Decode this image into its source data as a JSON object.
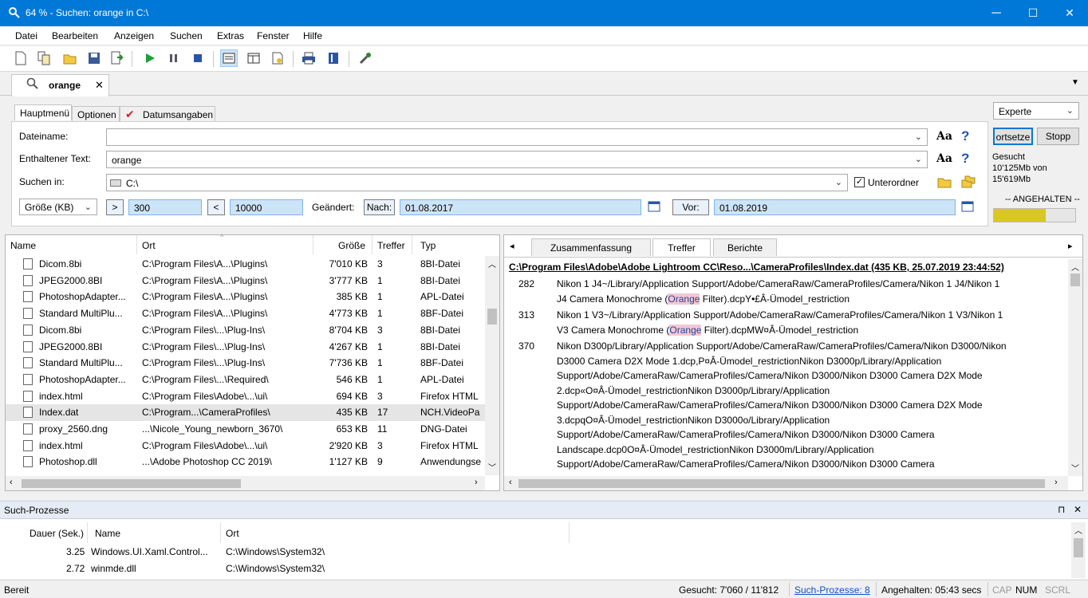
{
  "window": {
    "title": "64 % - Suchen: orange in C:\\",
    "minimize": "─",
    "maximize": "☐",
    "close": "✕",
    "app_icon": "search-flame-icon"
  },
  "menu": [
    "Datei",
    "Bearbeiten",
    "Anzeigen",
    "Suchen",
    "Extras",
    "Fenster",
    "Hilfe"
  ],
  "doc_tab": {
    "label": "orange",
    "close": "✕"
  },
  "search_panel": {
    "subtabs": [
      "Hauptmenü",
      "Optionen",
      "Datumsangaben"
    ],
    "filename_label": "Dateiname:",
    "filename_value": "",
    "contains_label": "Enthaltener Text:",
    "contains_value": "orange",
    "lookin_label": "Suchen in:",
    "lookin_value": "C:\\",
    "subfolders_label": "Unterordner",
    "size_filter": "Größe (KB)",
    "gt": ">",
    "size_min": "300",
    "lt": "<",
    "size_max": "10000",
    "changed_label": "Geändert:",
    "after_label": "Nach:",
    "after_value": "01.08.2017",
    "before_label": "Vor:",
    "before_value": "01.08.2019",
    "aa": "Aa",
    "help": "?"
  },
  "side": {
    "mode": "Experte",
    "continue": "ortsetze",
    "stop": "Stopp",
    "searched_label": "Gesucht",
    "searched_value": "10'125Mb von",
    "searched_total": "15'619Mb",
    "status": "-- ANGEHALTEN --",
    "progress": 0.64
  },
  "results": {
    "headers": [
      "Name",
      "Ort",
      "Größe",
      "Treffer",
      "Typ"
    ],
    "rows": [
      {
        "name": "Dicom.8bi",
        "ort": "C:\\Program Files\\A...\\Plugins\\",
        "size": "7'010 KB",
        "hits": "3",
        "type": "8BI-Datei"
      },
      {
        "name": "JPEG2000.8BI",
        "ort": "C:\\Program Files\\A...\\Plugins\\",
        "size": "3'777 KB",
        "hits": "1",
        "type": "8BI-Datei"
      },
      {
        "name": "PhotoshopAdapter...",
        "ort": "C:\\Program Files\\A...\\Plugins\\",
        "size": "385 KB",
        "hits": "1",
        "type": "APL-Datei"
      },
      {
        "name": "Standard MultiPlu...",
        "ort": "C:\\Program Files\\A...\\Plugins\\",
        "size": "4'773 KB",
        "hits": "1",
        "type": "8BF-Datei"
      },
      {
        "name": "Dicom.8bi",
        "ort": "C:\\Program Files\\...\\Plug-Ins\\",
        "size": "8'704 KB",
        "hits": "3",
        "type": "8BI-Datei"
      },
      {
        "name": "JPEG2000.8BI",
        "ort": "C:\\Program Files\\...\\Plug-Ins\\",
        "size": "4'267 KB",
        "hits": "1",
        "type": "8BI-Datei"
      },
      {
        "name": "Standard MultiPlu...",
        "ort": "C:\\Program Files\\...\\Plug-Ins\\",
        "size": "7'736 KB",
        "hits": "1",
        "type": "8BF-Datei"
      },
      {
        "name": "PhotoshopAdapter...",
        "ort": "C:\\Program Files\\...\\Required\\",
        "size": "546 KB",
        "hits": "1",
        "type": "APL-Datei"
      },
      {
        "name": "index.html",
        "ort": "C:\\Program Files\\Adobe\\...\\ui\\",
        "size": "694 KB",
        "hits": "3",
        "type": "Firefox HTML"
      },
      {
        "name": "Index.dat",
        "ort": "C:\\Program...\\CameraProfiles\\",
        "size": "435 KB",
        "hits": "17",
        "type": "NCH.VideoPa"
      },
      {
        "name": "proxy_2560.dng",
        "ort": "...\\Nicole_Young_newborn_3670\\",
        "size": "653 KB",
        "hits": "11",
        "type": "DNG-Datei"
      },
      {
        "name": "index.html",
        "ort": "C:\\Program Files\\Adobe\\...\\ui\\",
        "size": "2'920 KB",
        "hits": "3",
        "type": "Firefox HTML"
      },
      {
        "name": "Photoshop.dll",
        "ort": "...\\Adobe Photoshop CC 2019\\",
        "size": "1'127 KB",
        "hits": "9",
        "type": "Anwendungse"
      }
    ]
  },
  "preview": {
    "tabs": [
      "Zusammenfassung",
      "Treffer",
      "Berichte"
    ],
    "header": "C:\\Program Files\\Adobe\\Adobe Lightroom CC\\Reso...\\CameraProfiles\\Index.dat  (435 KB,  25.07.2019 23:44:52)",
    "hits": [
      {
        "num": "282",
        "l1": "Nikon 1 J4~/Library/Application Support/Adobe/CameraRaw/CameraProfiles/Camera/Nikon 1 J4/Nikon 1",
        "l2a": "J4 Camera Monochrome (",
        "l2h": "Orange",
        "l2b": " Filter).dcpY•£Â-Ümodel_restriction"
      },
      {
        "num": "313",
        "l1": "Nikon 1 V3~/Library/Application Support/Adobe/CameraRaw/CameraProfiles/Camera/Nikon 1 V3/Nikon 1",
        "l2a": "V3 Camera Monochrome (",
        "l2h": "Orange",
        "l2b": " Filter).dcpMW¤Â-Ümodel_restriction"
      }
    ],
    "hit3_num": "370",
    "hit3_lines": [
      "Nikon D300p/Library/Application Support/Adobe/CameraRaw/CameraProfiles/Camera/Nikon D3000/Nikon",
      "D3000 Camera D2X Mode 1.dcp,P¤Â-Ümodel_restrictionNikon D3000p/Library/Application",
      "Support/Adobe/CameraRaw/CameraProfiles/Camera/Nikon D3000/Nikon D3000 Camera D2X Mode",
      "2.dcp«O¤Â-Ümodel_restrictionNikon D3000p/Library/Application",
      "Support/Adobe/CameraRaw/CameraProfiles/Camera/Nikon D3000/Nikon D3000 Camera D2X Mode",
      "3.dcpqO¤Â-Ümodel_restrictionNikon D3000o/Library/Application",
      "Support/Adobe/CameraRaw/CameraProfiles/Camera/Nikon D3000/Nikon D3000 Camera",
      "Landscape.dcp0O¤Â-Ümodel_restrictionNikon D3000m/Library/Application",
      "Support/Adobe/CameraRaw/CameraProfiles/Camera/Nikon D3000/Nikon D3000 Camera"
    ]
  },
  "processes": {
    "title": "Such-Prozesse",
    "pin": "⊓",
    "close": "✕",
    "headers": [
      "Dauer (Sek.)",
      "Name",
      "Ort"
    ],
    "rows": [
      {
        "dur": "3.25",
        "name": "Windows.UI.Xaml.Control...",
        "ort": "C:\\Windows\\System32\\"
      },
      {
        "dur": "2.72",
        "name": "winmde.dll",
        "ort": "C:\\Windows\\System32\\"
      }
    ]
  },
  "status": {
    "ready": "Bereit",
    "searched": "Gesucht: 7'060 / 11'812",
    "procs": "Such-Prozesse: 8",
    "paused": "Angehalten: 05:43 secs",
    "cap": "CAP",
    "num": "NUM",
    "scrl": "SCRL"
  },
  "colors": {
    "titlebar": "#0078d7",
    "highlight": "#f5c6d4",
    "progress": "#d9c821"
  }
}
